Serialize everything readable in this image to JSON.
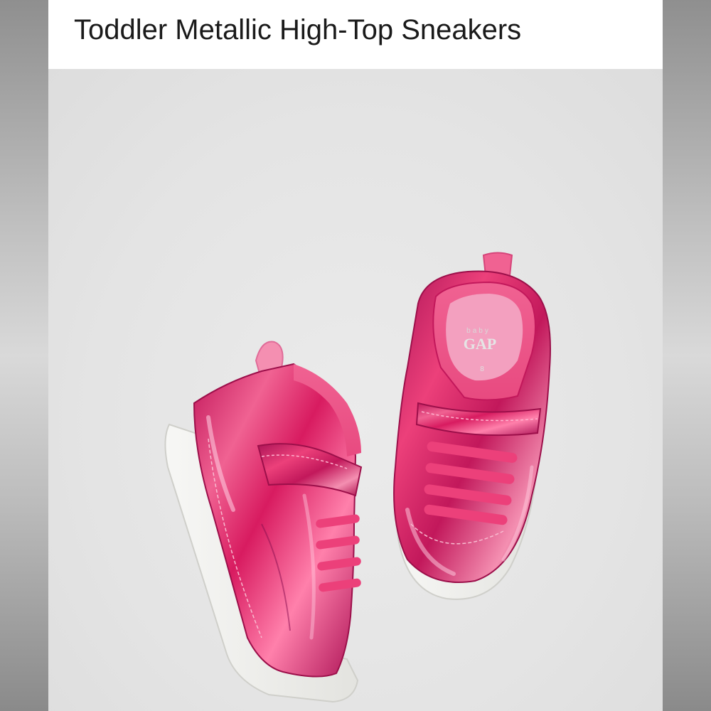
{
  "product": {
    "title": "Toddler Metallic High-Top Sneakers",
    "image_alt": "Pair of pink metallic high-top toddler sneakers",
    "insole_brand": "baby GAP",
    "insole_size": "8"
  },
  "colors": {
    "metallic_pink": "#d81b6a",
    "lining_pink": "#ef5b8e",
    "sole_white": "#f2f2ef",
    "background": "#e6e6e6"
  }
}
